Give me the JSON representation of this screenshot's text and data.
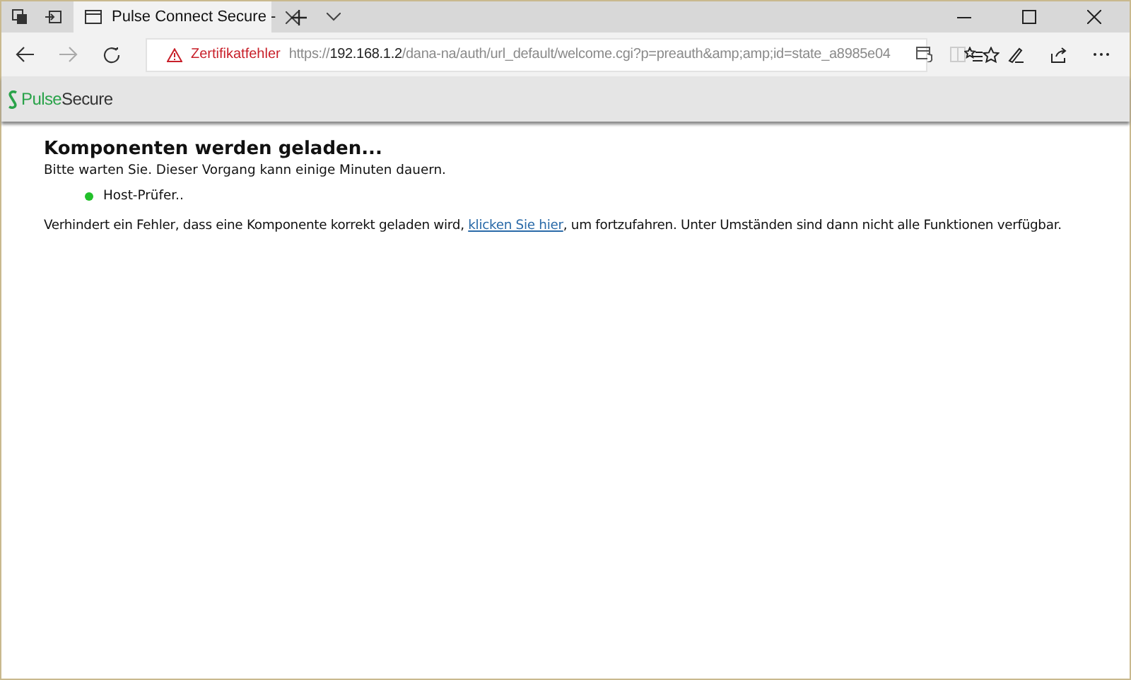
{
  "tab": {
    "title": "Pulse Connect Secure -",
    "selected": true
  },
  "address": {
    "warning": "Zertifikatfehler",
    "scheme": "https://",
    "host": "192.168.1.2",
    "path": "/dana-na/auth/url_default/welcome.cgi?p=preauth&amp;amp;id=state_a8985e04"
  },
  "brand": {
    "first": "Pulse",
    "second": "Secure"
  },
  "content": {
    "heading": "Komponenten werden geladen...",
    "subtitle": "Bitte warten Sie. Dieser Vorgang kann einige Minuten dauern.",
    "components": [
      {
        "name": "Host-Prüfer..",
        "color": "#22c02a"
      }
    ],
    "notice": {
      "before": "Verhindert ein Fehler, dass eine Komponente korrekt geladen wird, ",
      "link": "klicken Sie hier",
      "after": ", um fortzufahren. Unter Umständen sind dann nicht alle Funktionen verfügbar."
    }
  }
}
